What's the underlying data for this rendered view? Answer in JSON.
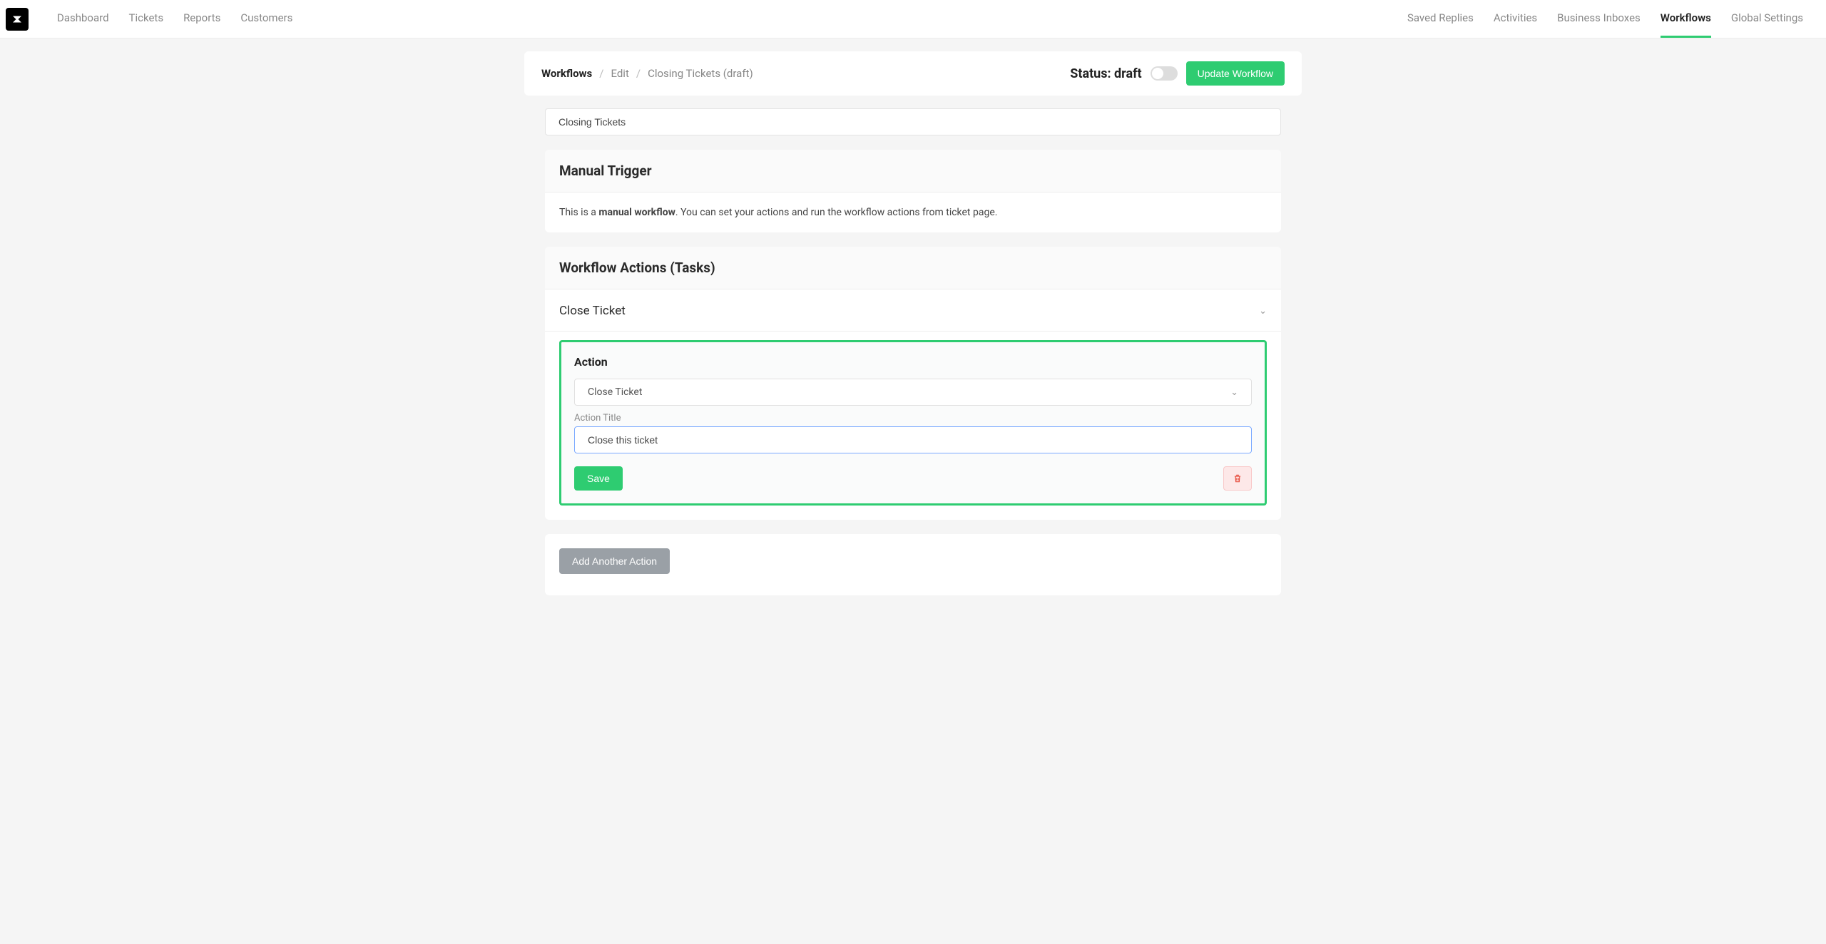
{
  "nav": {
    "left": [
      "Dashboard",
      "Tickets",
      "Reports",
      "Customers"
    ],
    "right": [
      "Saved Replies",
      "Activities",
      "Business Inboxes",
      "Workflows",
      "Global Settings"
    ],
    "active": "Workflows"
  },
  "breadcrumb": {
    "items": [
      "Workflows",
      "Edit",
      "Closing Tickets (draft)"
    ]
  },
  "status": {
    "label": "Status: draft"
  },
  "buttons": {
    "update": "Update Workflow",
    "save": "Save",
    "add_another": "Add Another Action"
  },
  "workflow_name": "Closing Tickets",
  "trigger_card": {
    "title": "Manual Trigger",
    "text_pre": "This is a ",
    "text_bold": "manual workflow",
    "text_post": ". You can set your actions and run the workflow actions from ticket page."
  },
  "actions_card": {
    "title": "Workflow Actions (Tasks)",
    "block_title": "Close Ticket",
    "panel": {
      "label": "Action",
      "select_value": "Close Ticket",
      "title_label": "Action Title",
      "title_value": "Close this ticket"
    }
  }
}
